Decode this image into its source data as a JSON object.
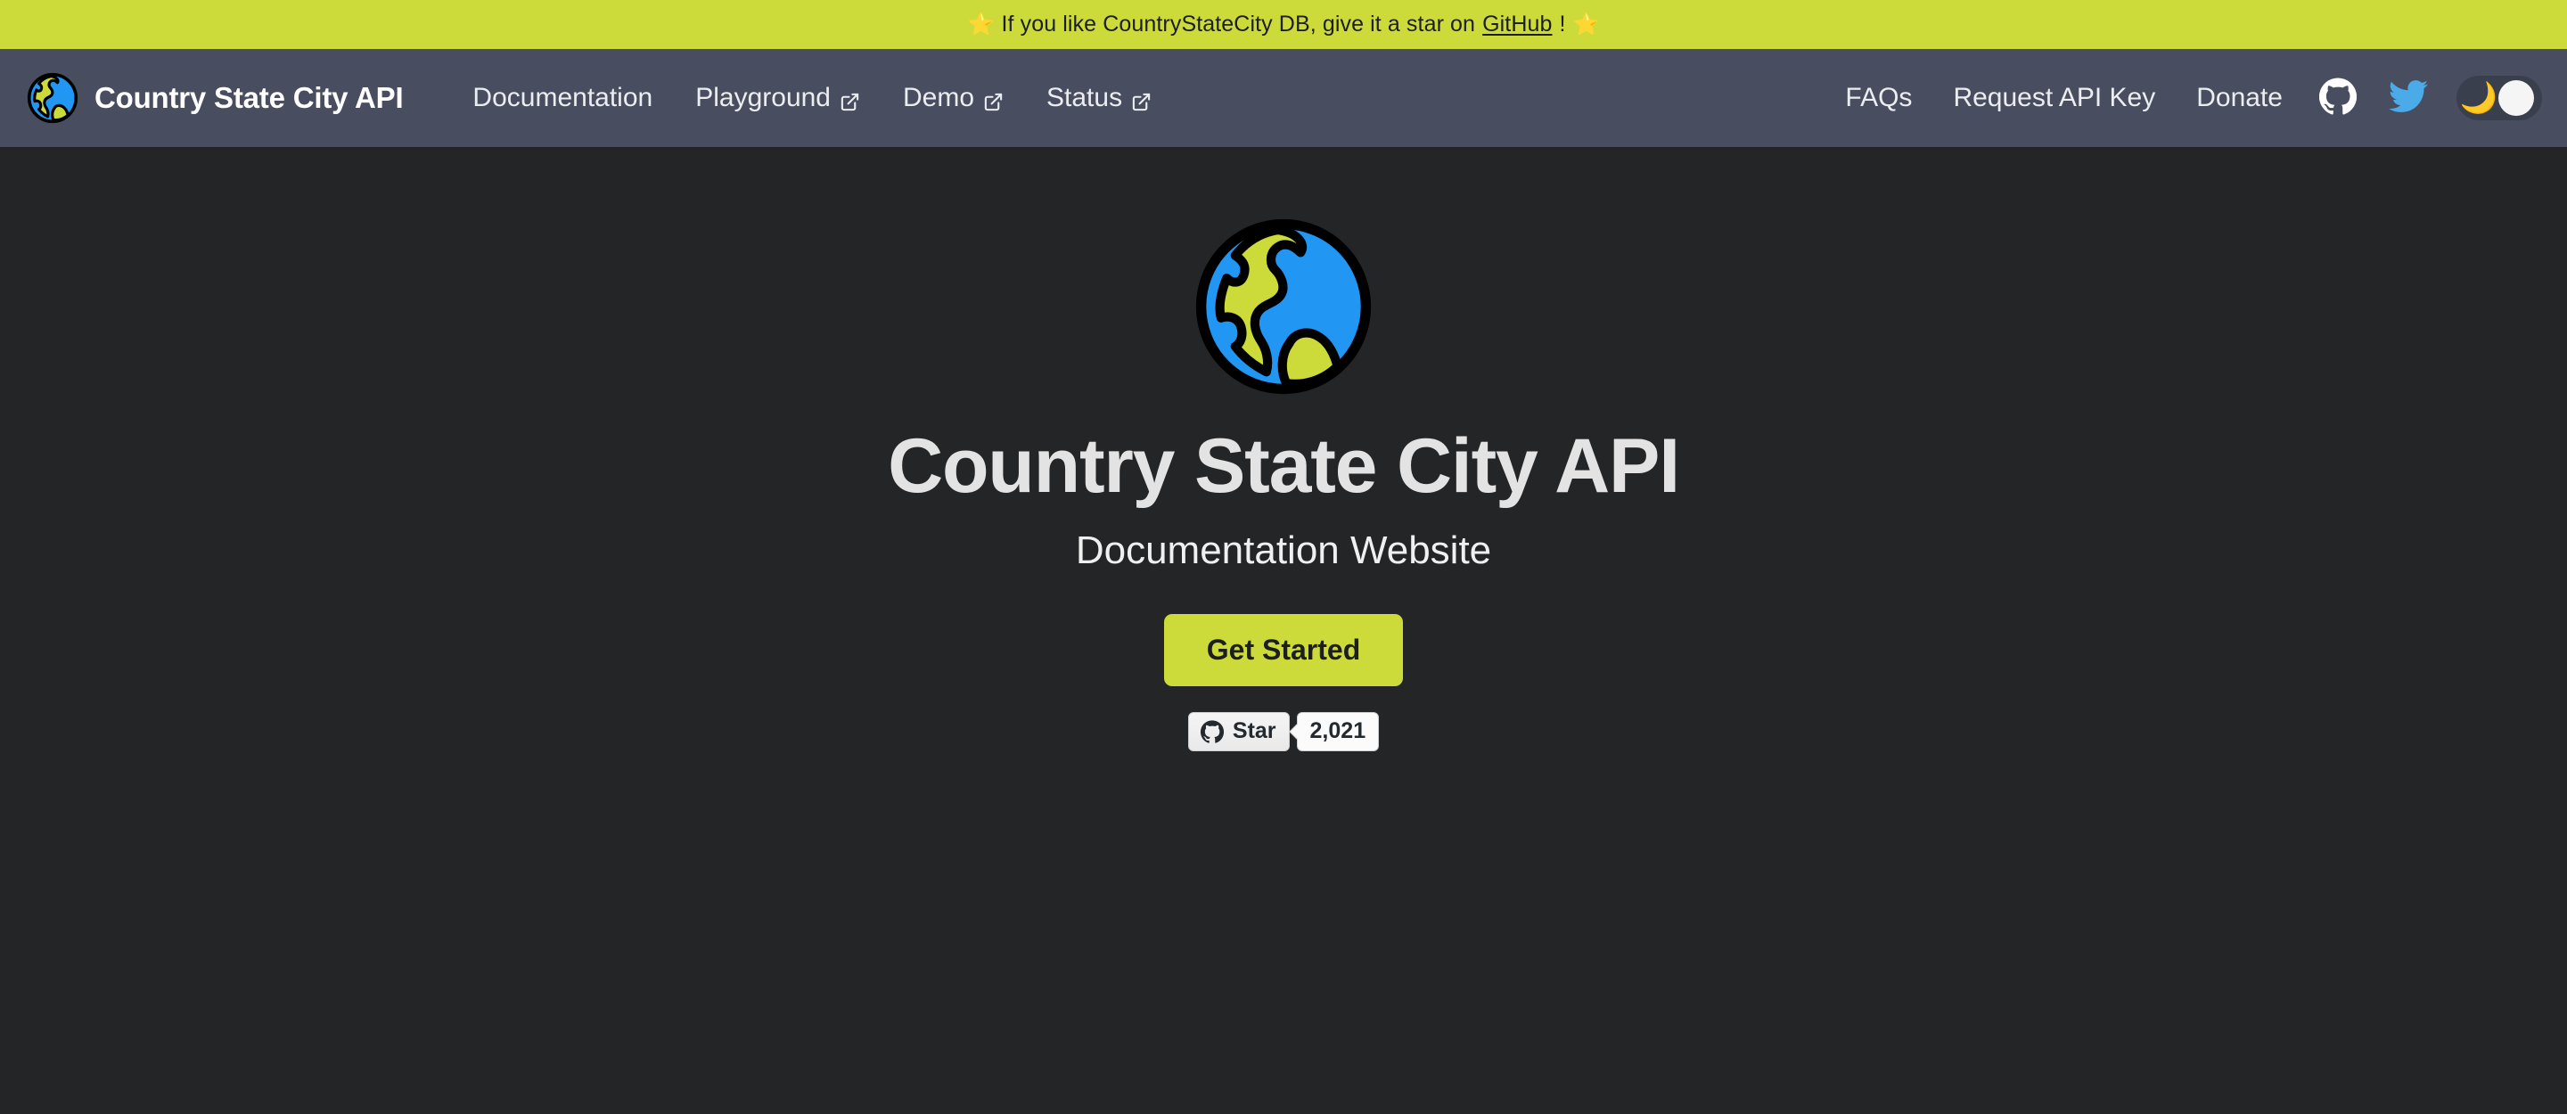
{
  "announcement": {
    "star_left": "⭐",
    "star_right": "⭐",
    "text_before": "If you like CountryStateCity DB, give it a star on ",
    "link_label": "GitHub",
    "text_after": "!",
    "background_color": "#ccdb39",
    "text_color": "#1c1e21"
  },
  "navbar": {
    "background_color": "#484e60",
    "brand": {
      "label": "Country State City API",
      "logo_icon": "globe-icon"
    },
    "links": [
      {
        "label": "Documentation",
        "external": false
      },
      {
        "label": "Playground",
        "external": true
      },
      {
        "label": "Demo",
        "external": true
      },
      {
        "label": "Status",
        "external": true
      }
    ],
    "right_links": [
      {
        "label": "FAQs"
      },
      {
        "label": "Request API Key"
      },
      {
        "label": "Donate"
      }
    ],
    "icons": [
      {
        "name": "github-icon"
      },
      {
        "name": "twitter-icon"
      }
    ],
    "theme_toggle": {
      "moon_glyph": "🌙",
      "state": "dark"
    }
  },
  "hero": {
    "logo_icon": "globe-icon",
    "title": "Country State City API",
    "subtitle": "Documentation Website",
    "cta_label": "Get Started",
    "background_color": "#242526",
    "accent_color": "#ccdb39",
    "github_star": {
      "icon": "github-icon",
      "label": "Star",
      "count": "2,021"
    }
  }
}
